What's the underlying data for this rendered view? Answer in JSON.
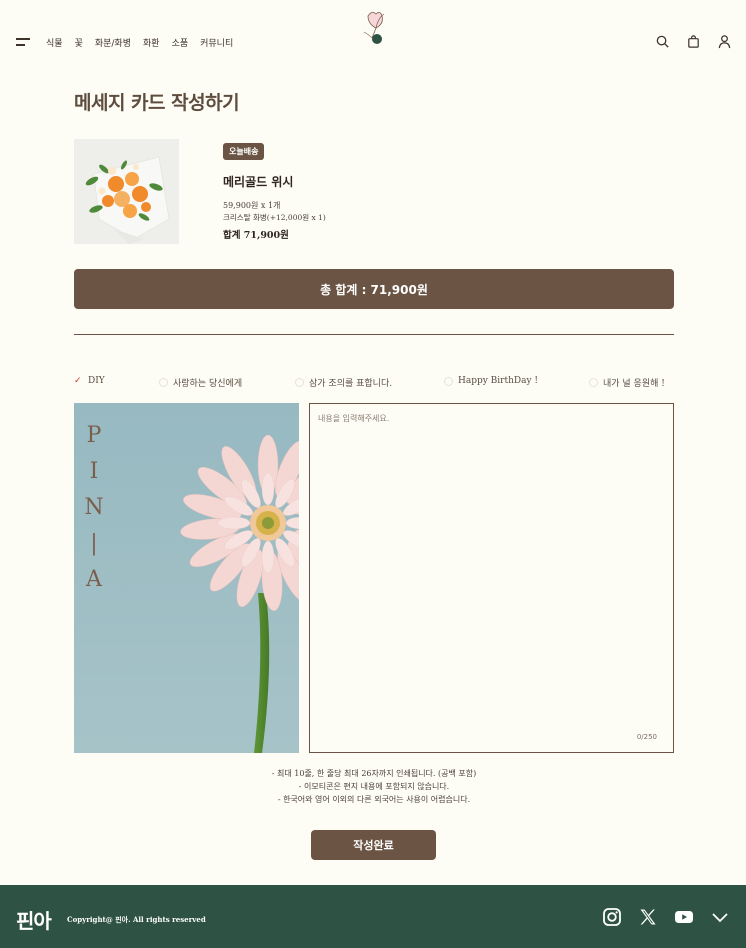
{
  "nav": {
    "items": [
      "식물",
      "꽃",
      "화분/화병",
      "화환",
      "소품",
      "커뮤니티"
    ]
  },
  "page": {
    "title": "메세지 카드 작성하기"
  },
  "product": {
    "badge": "오늘배송",
    "name": "메리골드 위시",
    "price_line": "59,900원 x 1개",
    "option_line": "크리스탈 화병(+12,000원 x 1)",
    "subtotal": "합계 71,900원"
  },
  "total_bar": {
    "label": "총 합계 : 71,900원"
  },
  "messages": {
    "options": [
      "DIY",
      "사랑하는 당신에게",
      "삼가 조의를 표합니다.",
      "Happy BirthDay !",
      "내가 널 응원해 !"
    ],
    "selected": "DIY"
  },
  "card": {
    "letters": [
      "P",
      "I",
      "N",
      "|",
      "A"
    ]
  },
  "editor": {
    "placeholder": "내용을 입력해주세요.",
    "counter": "0/250"
  },
  "notes": [
    "- 최대 10줄, 한 줄당 최대 26자까지 인쇄됩니다. (공백 포함)",
    "- 이모티콘은 편지 내용에 포함되지 않습니다.",
    "- 한국어와 영어 이외의 다른 외국어는 사용이 어렵습니다."
  ],
  "submit": {
    "label": "작성완료"
  },
  "footer": {
    "logo": "핀아",
    "copyright": "Copyright@ 핀아. All rights reserved"
  },
  "colors": {
    "accent": "#6b5444",
    "footer_bg": "#2e5244",
    "page_bg": "#fdfcf5",
    "check": "#c0392b"
  }
}
